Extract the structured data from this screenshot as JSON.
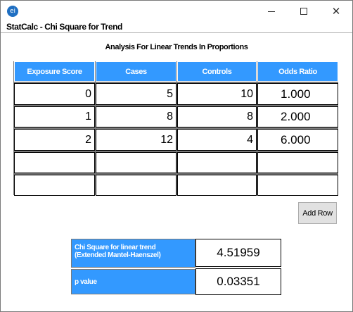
{
  "window": {
    "app_icon": "ei",
    "title": "StatCalc - Chi Square for Trend",
    "controls": [
      "minimize-icon",
      "maximize-icon",
      "close-icon"
    ]
  },
  "subtitle": "Analysis For Linear Trends In Proportions",
  "table": {
    "headers": [
      "Exposure Score",
      "Cases",
      "Controls",
      "Odds Ratio"
    ],
    "rows": [
      [
        "0",
        "5",
        "10",
        "1.000"
      ],
      [
        "1",
        "8",
        "8",
        "2.000"
      ],
      [
        "2",
        "12",
        "4",
        "6.000"
      ],
      [
        "",
        "",
        "",
        ""
      ],
      [
        "",
        "",
        "",
        ""
      ]
    ]
  },
  "add_row_label": "Add Row",
  "results": {
    "chi_square_label_line1": "Chi Square for linear trend",
    "chi_square_label_line2": "(Extended Mantel-Haenszel)",
    "chi_square_value": "4.51959",
    "p_value_label": "p value",
    "p_value": "0.03351"
  },
  "colors": {
    "header_blue": "#3399ff",
    "window_border": "#7a7a7a"
  }
}
